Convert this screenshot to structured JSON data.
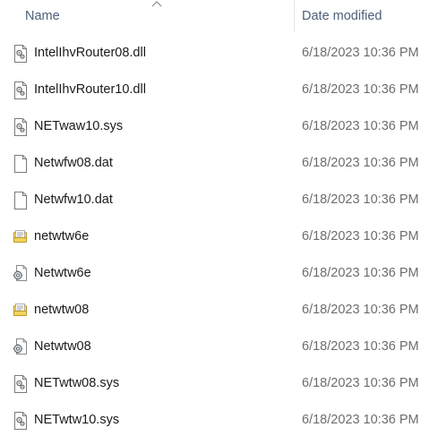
{
  "header": {
    "name_label": "Name",
    "date_label": "Date modified",
    "sort_icon": "chevron-up-icon"
  },
  "files": [
    {
      "name": "IntelIhvRouter08.dll",
      "date": "6/18/2023 10:36 PM",
      "icon": "system-file-icon"
    },
    {
      "name": "IntelIhvRouter10.dll",
      "date": "6/18/2023 10:36 PM",
      "icon": "system-file-icon"
    },
    {
      "name": "NETwaw10.sys",
      "date": "6/18/2023 10:36 PM",
      "icon": "system-file-icon"
    },
    {
      "name": "Netwfw08.dat",
      "date": "6/18/2023 10:36 PM",
      "icon": "blank-file-icon"
    },
    {
      "name": "Netwfw10.dat",
      "date": "6/18/2023 10:36 PM",
      "icon": "blank-file-icon"
    },
    {
      "name": "netwtw6e",
      "date": "6/18/2023 10:36 PM",
      "icon": "setup-info-icon"
    },
    {
      "name": "Netwtw6e",
      "date": "6/18/2023 10:36 PM",
      "icon": "catalog-gear-icon"
    },
    {
      "name": "netwtw08",
      "date": "6/18/2023 10:36 PM",
      "icon": "setup-info-icon"
    },
    {
      "name": "Netwtw08",
      "date": "6/18/2023 10:36 PM",
      "icon": "catalog-gear-icon"
    },
    {
      "name": "NETwtw08.sys",
      "date": "6/18/2023 10:36 PM",
      "icon": "system-file-icon"
    },
    {
      "name": "NETwtw10.sys",
      "date": "6/18/2023 10:36 PM",
      "icon": "system-file-icon"
    }
  ]
}
